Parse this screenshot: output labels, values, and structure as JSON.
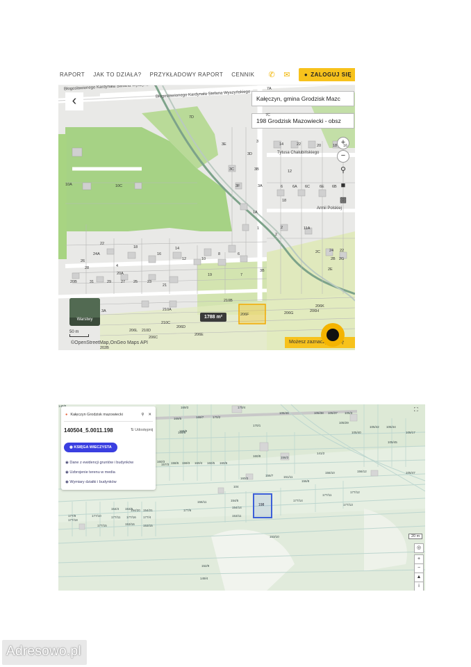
{
  "top": {
    "nav": {
      "links": [
        "RAPORT",
        "JAK TO DZIAŁA?",
        "PRZYKŁADOWY RAPORT",
        "CENNIK"
      ],
      "login_label": "ZALOGUJ SIĘ"
    },
    "map": {
      "address_line1": "Kałęczyn, gmina Grodzisk Mazc",
      "address_line2": "198 Grodzisk Mazowiecki - obsz",
      "area_label": "1788 m²",
      "layer_label": "Warstwy",
      "scale_label": "50 m",
      "attribution": "©OpenStreetMap,OnGeo Maps API",
      "hint": "Możesz zaznaczyć działę",
      "zoom_in": "+",
      "zoom_out": "−",
      "streets": [
        "Błogosławionego Kardynała Stefana Wyszyńskiego",
        "Błogosławionego Kardynała Stefana Wyszyńskiego",
        "Tytusa Chałubińskiego",
        "Armii Polskiej"
      ],
      "parcel_labels": [
        "7A",
        "7C",
        "7D",
        "3",
        "3E",
        "3D",
        "3C",
        "3B",
        "3F",
        "3A",
        "1A",
        "1",
        "2",
        "14",
        "22",
        "20",
        "18",
        "16",
        "12",
        "6",
        "6A",
        "6C",
        "6E",
        "6B",
        "18",
        "2",
        "11A",
        "2C",
        "24",
        "22",
        "2B",
        "2G",
        "2E",
        "10A",
        "10C",
        "22",
        "24A",
        "26",
        "28",
        "18",
        "16",
        "14",
        "12",
        "10",
        "8",
        "6",
        "4",
        "20A",
        "20B",
        "31",
        "29",
        "27",
        "25",
        "23",
        "21",
        "19",
        "7",
        "3B",
        "3A",
        "210A",
        "210B",
        "210C",
        "210D",
        "206L",
        "206C",
        "206D",
        "206E",
        "206F",
        "206G",
        "206H",
        "206K",
        "202B"
      ]
    }
  },
  "bottom": {
    "search_text": "Kałęczyn Grodzisk mazowiecki",
    "parcel_id": "140504_5.0011.198",
    "share_label": "Udostępnij",
    "kw_button": "KSIĘGA WIECZYSTA",
    "links": [
      "Dane z ewidencji gruntów i budynków",
      "Uzbrojenie terenu w media",
      "Wymiary działki i budynków"
    ],
    "selected_parcel": "198",
    "scale_label": "20 m",
    "parcel_labels": [
      "169/3",
      "170/4",
      "169/5",
      "169/7",
      "170/2",
      "169/9",
      "170/1",
      "169/8",
      "105/46",
      "105/38",
      "105/37",
      "105/3",
      "105/29",
      "105/40",
      "105/42",
      "105/44",
      "105/45",
      "105/17",
      "105/47",
      "141/2",
      "160/3",
      "160/8",
      "156/3",
      "157/3",
      "158/6",
      "159/3",
      "160/4",
      "160/5",
      "160/6",
      "160/3",
      "156/7",
      "156/8",
      "156/10",
      "156/12",
      "104",
      "151/11",
      "156/11",
      "154/5",
      "154/14",
      "177/14",
      "177/11",
      "177/12",
      "177/13",
      "153/6",
      "154/4",
      "154/20",
      "154/21",
      "177/6",
      "177/9",
      "177/10",
      "177/11",
      "177/16",
      "177/4",
      "177/18",
      "177/15",
      "153/16",
      "153/15",
      "153/11",
      "153/10",
      "152/9",
      "149/4",
      "149/8"
    ]
  },
  "watermark": "Adresowo.pl",
  "colors": {
    "accent": "#f7c21c",
    "button_blue": "#3a3fe0",
    "selection_blue": "#3c5fd8"
  }
}
